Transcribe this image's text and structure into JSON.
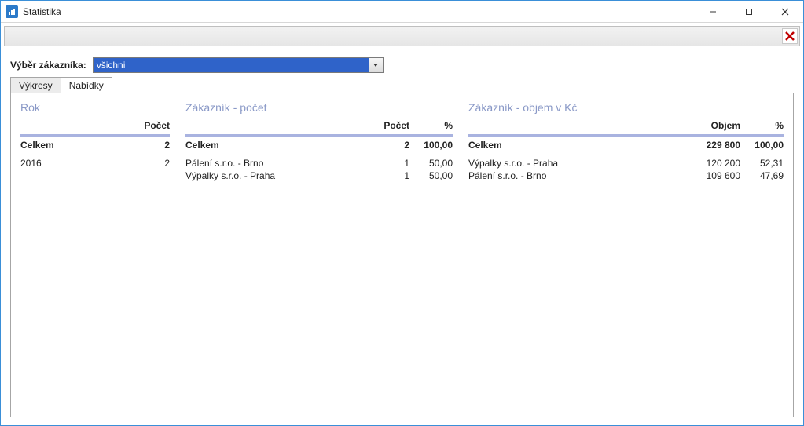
{
  "window": {
    "title": "Statistika"
  },
  "toolbar": {
    "close_icon_name": "close-icon"
  },
  "filter": {
    "label": "Výběr zákazníka:",
    "value": "všichni"
  },
  "tabs": [
    {
      "label": "Výkresy",
      "active": false
    },
    {
      "label": "Nabídky",
      "active": true
    }
  ],
  "section_rok": {
    "title": "Rok",
    "count_header": "Počet",
    "total_label": "Celkem",
    "total_count": "2",
    "rows": [
      {
        "label": "2016",
        "count": "2"
      }
    ]
  },
  "section_pocet": {
    "title": "Zákazník - počet",
    "count_header": "Počet",
    "pct_header": "%",
    "total_label": "Celkem",
    "total_count": "2",
    "total_pct": "100,00",
    "rows": [
      {
        "label": "Pálení s.r.o. - Brno",
        "count": "1",
        "pct": "50,00"
      },
      {
        "label": "Výpalky s.r.o. - Praha",
        "count": "1",
        "pct": "50,00"
      }
    ]
  },
  "section_objem": {
    "title": "Zákazník - objem v Kč",
    "amount_header": "Objem",
    "pct_header": "%",
    "total_label": "Celkem",
    "total_amount": "229 800",
    "total_pct": "100,00",
    "rows": [
      {
        "label": "Výpalky s.r.o. - Praha",
        "amount": "120 200",
        "pct": "52,31"
      },
      {
        "label": "Pálení s.r.o. - Brno",
        "amount": "109 600",
        "pct": "47,69"
      }
    ]
  }
}
